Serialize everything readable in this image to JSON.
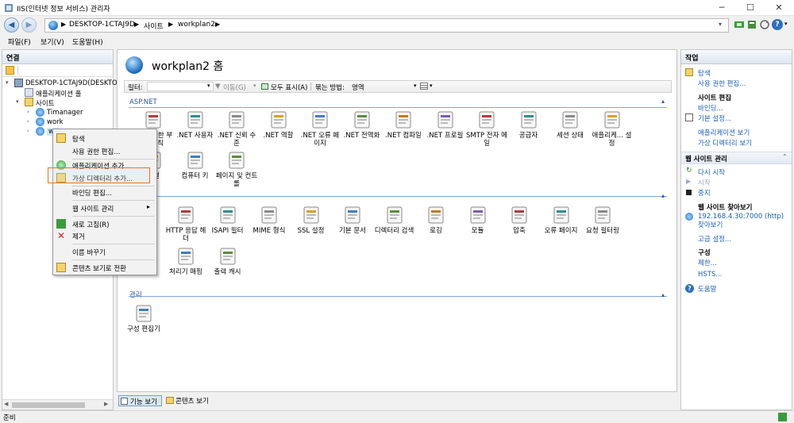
{
  "window": {
    "title": "IIS(인터넷 정보 서비스) 관리자",
    "controls": {
      "minimize": "─",
      "maximize": "☐",
      "close": "✕"
    }
  },
  "address": {
    "crumbs": [
      "DESKTOP-1CTAJ9D",
      "사이트",
      "workplan2"
    ],
    "sep": "▶",
    "help_icon": "?"
  },
  "menu": [
    "파일(F)",
    "보기(V)",
    "도움말(H)"
  ],
  "left": {
    "header": "연결",
    "tree": {
      "server": "DESKTOP-1CTAJ9D(DESKTOP",
      "app_pools": "애플리케이션 풀",
      "sites": "사이트",
      "site_items": [
        "Timanager",
        "work",
        "wo"
      ]
    }
  },
  "center": {
    "title": "workplan2 홈",
    "filter_label": "필터:",
    "go_label": "이동(G)",
    "show_all_label": "모두 표시(A)",
    "group_by_label": "묶는 방법:",
    "group_by_value": "영역",
    "groups": {
      "aspnet": "ASP.NET",
      "manage": "관리"
    },
    "aspnet_row1": [
      ".NET 권한 부여 규칙",
      ".NET 사용자",
      ".NET 신뢰 수준",
      ".NET 역할",
      ".NET 오류 페이지",
      ".NET 전역화",
      ".NET 컴파일",
      ".NET 프로필",
      "SMTP 전자 메일",
      "공급자",
      "세션 상태",
      "애플리케... 설정"
    ],
    "aspnet_row2": [
      "연결",
      "컴퓨터 키",
      "페이지 및 컨트롤"
    ],
    "iis_row1": [
      "HTTP 응답 헤더",
      "ISAPI 필터",
      "MIME 형식",
      "SSL 설정",
      "기본 문서",
      "디렉터리 검색",
      "로깅",
      "모듈",
      "압축",
      "오류 페이지",
      "요청 필터링"
    ],
    "iis_row2": [
      "처리기 매핑",
      "출력 캐시"
    ],
    "manage_row": [
      "구성 편집기"
    ],
    "error_badge": "404"
  },
  "viewbar": {
    "features": "기능 보기",
    "content": "콘텐츠 보기"
  },
  "right": {
    "header": "작업",
    "explore": "탐색",
    "edit_perm": "사용 권한 편집...",
    "site_edit_title": "사이트 편집",
    "bindings": "바인딩...",
    "basic_settings": "기본 설정...",
    "view_apps": "애플리케이션 보기",
    "view_vdirs": "가상 디렉터리 보기",
    "manage_site_title": "웹 사이트 관리",
    "restart": "다시 시작",
    "start": "시작",
    "stop": "중지",
    "browse_title": "웹 사이트 찾아보기",
    "browse_link": "192.168.4.30:7000 (http) 찾아보기",
    "advanced": "고급 설정...",
    "config_title": "구성",
    "limits": "제한...",
    "hsts": "HSTS...",
    "help": "도움말"
  },
  "status": {
    "text": "준비"
  },
  "context_menu": [
    "탐색",
    "사용 권한 편집...",
    "애플리케이션 추가...",
    "가상 디렉터리 추가...",
    "바인딩 편집...",
    "웹 사이트 관리",
    "새로 고침(R)",
    "제거",
    "이름 바꾸기",
    "콘텐츠 보기로 전환"
  ],
  "submenu_arrow": "▸",
  "colors": {
    "accent": "#1a5fb4",
    "highlight": "#e8761b",
    "group": "#2a55a0"
  }
}
